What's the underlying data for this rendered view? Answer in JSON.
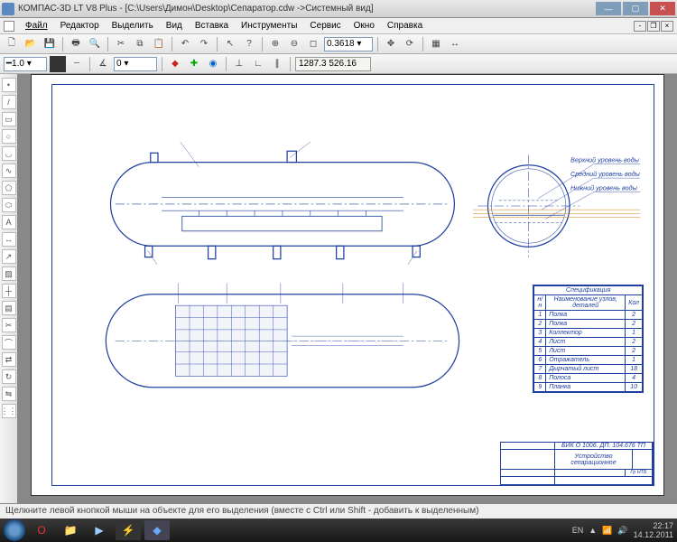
{
  "title": "КОМПАС-3D LT V8 Plus - [C:\\Users\\Димон\\Desktop\\Сепаратор.cdw ->Системный вид]",
  "menu": [
    "Файл",
    "Редактор",
    "Выделить",
    "Вид",
    "Вставка",
    "Инструменты",
    "Сервис",
    "Окно",
    "Справка"
  ],
  "combo_linewidth": "1.0",
  "combo_step": "0",
  "combo_zoom": "0.3618",
  "readout_coords": "1287.3  526.16",
  "status": "Щелкните левой кнопкой мыши на объекте для его выделения (вместе с Ctrl или Shift - добавить к выделенным)",
  "annotations": {
    "a1": "Верхний уровень воды",
    "a2": "Средний уровень воды",
    "a3": "Нижний уровень воды"
  },
  "spec": {
    "title": "Спецификация",
    "head": [
      "н/н",
      "Наименование узлов, деталей",
      "Кол"
    ],
    "rows": [
      [
        "1",
        "Полка",
        "2"
      ],
      [
        "2",
        "Полка",
        "2"
      ],
      [
        "3",
        "Коллектор",
        "1"
      ],
      [
        "4",
        "Лист",
        "2"
      ],
      [
        "5",
        "Лист",
        "2"
      ],
      [
        "6",
        "Отражатель",
        "1"
      ],
      [
        "7",
        "Дырчатый лист",
        "18"
      ],
      [
        "8",
        "Полоса",
        "4"
      ],
      [
        "9",
        "Планка",
        "10"
      ]
    ]
  },
  "stamp": {
    "code": "БИК О 1006. ДП. 104.676 ТП",
    "name": "Устройство сепарационное",
    "org": "Гр НТБ"
  },
  "tray_lang": "EN",
  "clock_time": "22:17",
  "clock_date": "14.12.2011"
}
